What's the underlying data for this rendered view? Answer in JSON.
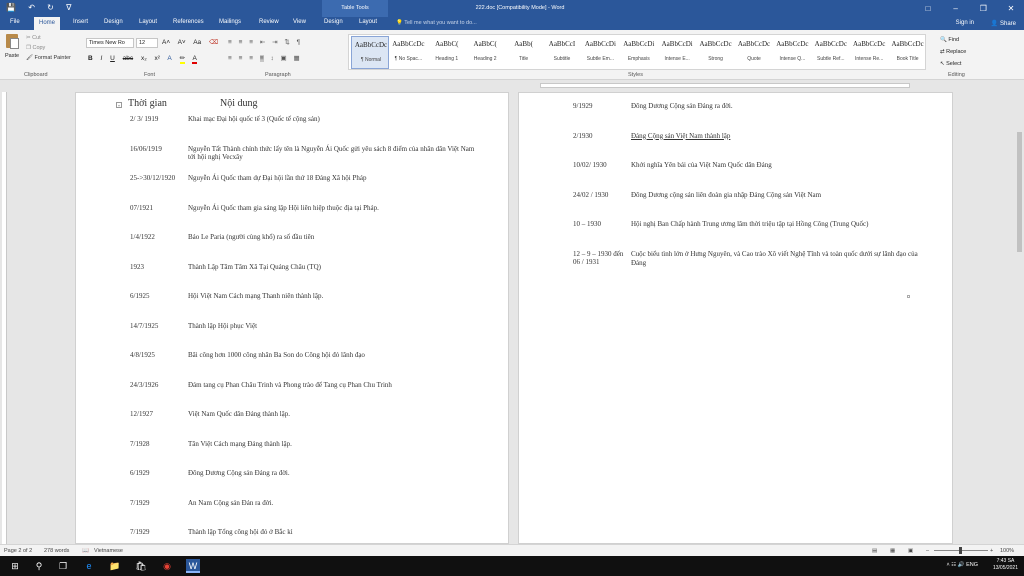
{
  "titlebar": {
    "save_icon": "save-icon",
    "undo_icon": "undo-icon",
    "redo_icon": "redo-icon",
    "context_tab": "Table Tools",
    "title": "222.doc [Compatibility Mode] - Word",
    "accent": "#2b579a"
  },
  "tabs": [
    "File",
    "Home",
    "Insert",
    "Design",
    "Layout",
    "References",
    "Mailings",
    "Review",
    "View",
    "Design",
    "Layout"
  ],
  "tellme": "Tell me what you want to do...",
  "signin": "Sign in",
  "share": "Share",
  "ribbon": {
    "clipboard": {
      "paste": "Paste",
      "cut": "Cut",
      "copy": "Copy",
      "format_painter": "Format Painter",
      "label": "Clipboard"
    },
    "font": {
      "name": "Times New Ro",
      "size": "12",
      "label": "Font"
    },
    "paragraph": {
      "label": "Paragraph"
    },
    "styles": {
      "label": "Styles",
      "items": [
        {
          "preview": "AaBbCcDc",
          "name": "¶ Normal"
        },
        {
          "preview": "AaBbCcDc",
          "name": "¶ No Spac..."
        },
        {
          "preview": "AaBbC(",
          "name": "Heading 1"
        },
        {
          "preview": "AaBbC(",
          "name": "Heading 2"
        },
        {
          "preview": "AaBb(",
          "name": "Title"
        },
        {
          "preview": "AaBbCcI",
          "name": "Subtitle"
        },
        {
          "preview": "AaBbCcDi",
          "name": "Subtle Em..."
        },
        {
          "preview": "AaBbCcDi",
          "name": "Emphasis"
        },
        {
          "preview": "AaBbCcDi",
          "name": "Intense E..."
        },
        {
          "preview": "AaBbCcDc",
          "name": "Strong"
        },
        {
          "preview": "AaBbCcDc",
          "name": "Quote"
        },
        {
          "preview": "AaBbCcDc",
          "name": "Intense Q..."
        },
        {
          "preview": "AaBbCcDc",
          "name": "Subtle Ref..."
        },
        {
          "preview": "AaBbCcDc",
          "name": "Intense Re..."
        },
        {
          "preview": "AaBbCcDc",
          "name": "Book Title"
        }
      ]
    },
    "editing": {
      "find": "Find",
      "replace": "Replace",
      "select": "Select",
      "label": "Editing"
    }
  },
  "doc": {
    "header": {
      "time": "Thời gian",
      "content": "Nội dung"
    },
    "left_rows": [
      {
        "time": "2/ 3/ 1919",
        "content": "Khai mạc Đại hội quốc tế 3 (Quốc tế cộng sản)"
      },
      {
        "time": "16/06/1919",
        "content": "Nguyễn Tất Thành chính thức lấy tên là Nguyễn Ái Quốc gửi yêu sách 8 điểm của nhân dân Việt Nam tới hội nghị Vecxây"
      },
      {
        "time": "25->30/12/1920",
        "content": "Nguyễn Ái Quốc tham dự Đại hội lần thứ 18 Đảng Xã hội Pháp"
      },
      {
        "time": "07/1921",
        "content": "Nguyễn Ái Quốc tham gia sáng lập Hội liên hiệp thuộc địa tại Pháp."
      },
      {
        "time": "1/4/1922",
        "content": "Báo Le Paria (người cùng khổ) ra số đầu tiên"
      },
      {
        "time": "1923",
        "content": "Thành Lập Tâm Tâm Xã Tại Quảng Châu (TQ)"
      },
      {
        "time": "6/1925",
        "content": "Hội Việt Nam Cách mạng Thanh niên thành lập."
      },
      {
        "time": "14/7/1925",
        "content": "Thành lập Hội phục Việt"
      },
      {
        "time": "4/8/1925",
        "content": "Bãi công hơn 1000 công nhân Ba Son do Công hội đỏ lãnh đạo"
      },
      {
        "time": "24/3/1926",
        "content": "Đám tang cụ Phan Châu Trinh và Phong trào để Tang cụ Phan Chu Trinh"
      },
      {
        "time": "12/1927",
        "content": "Việt Nam Quốc dân Đảng thành lập."
      },
      {
        "time": "7/1928",
        "content": "Tân Việt Cách mạng Đảng thành lập."
      },
      {
        "time": "6/1929",
        "content": "Đông Dương Cộng sản Đảng ra đời."
      },
      {
        "time": "7/1929",
        "content": "An Nam Cộng sản Đản ra đời."
      },
      {
        "time": "7/1929",
        "content": "Thành lập Tổng công hội đỏ ở Bắc kì"
      }
    ],
    "right_rows": [
      {
        "time": "9/1929",
        "content": "Đông Dương Cộng sản Đảng ra đời."
      },
      {
        "time": "2/1930",
        "content": "Đảng Cộng sản Việt Nam thành lập"
      },
      {
        "time": "10/02/ 1930",
        "content": "Khởi nghĩa Yên bái của Việt Nam Quốc dân Đảng"
      },
      {
        "time": "24/02 / 1930",
        "content": "Đông Dương cộng sản liên đoàn gia nhập Đảng Cộng sản Việt Nam"
      },
      {
        "time": "10 – 1930",
        "content": "Hội nghị Ban Chấp hành Trung ương lâm thời triệu tập tại Hồng Công (Trung Quốc)"
      },
      {
        "time": "12 – 9 – 1930 đến 06 / 1931",
        "content": "Cuộc biểu tình lớn ở Hưng Nguyên, và Cao trào Xô viết Nghệ Tĩnh và toàn quốc dưới sự lãnh đạo của Đảng"
      }
    ]
  },
  "status": {
    "page": "Page 2 of 2",
    "words": "278 words",
    "lang": "Vietnamese",
    "zoom": "100%"
  },
  "taskbar": {
    "time": "7:43 SA",
    "date": "13/05/2021",
    "lang": "ENG"
  }
}
